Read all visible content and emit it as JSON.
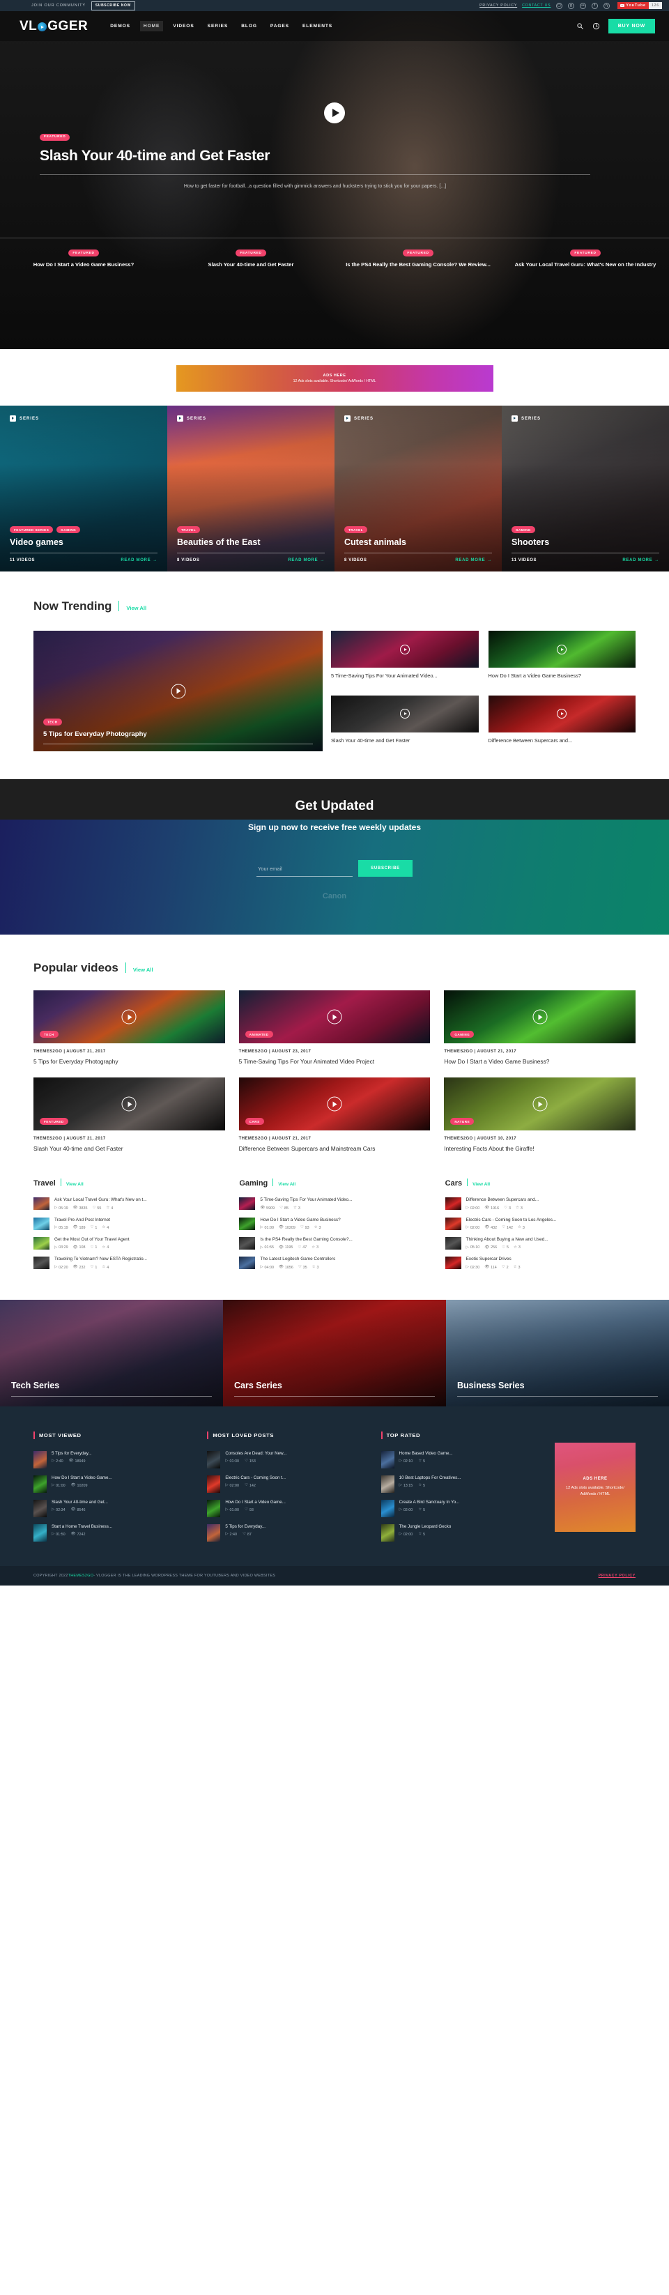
{
  "topbar": {
    "join_text": "JOIN OUR COMMUNITY",
    "subscribe_label": "SUBSCRIBE NOW",
    "links": [
      "PRIVACY POLICY",
      "CONTACT US"
    ],
    "social": [
      "instagram-icon",
      "google-plus-icon",
      "medium-icon",
      "facebook-icon",
      "behance-icon"
    ],
    "youtube_label": "YouTube",
    "youtube_count": "126"
  },
  "nav": {
    "logo": "VL",
    "logo_suffix": "GGER",
    "items": [
      "DEMOS",
      "HOME",
      "VIDEOS",
      "SERIES",
      "BLOG",
      "PAGES",
      "ELEMENTS"
    ],
    "active_index": 1,
    "buy_now": "BUY NOW",
    "accent": "#19dca6"
  },
  "hero": {
    "badge": "FEATURED",
    "title": "Slash Your 40-time and Get Faster",
    "desc": "How to get faster for football...a question filled with gimmick answers and hucksters trying to stick you for your papers. [...]",
    "strip": [
      {
        "badge": "FEATURED",
        "title": "How Do I Start a Video Game Business?"
      },
      {
        "badge": "FEATURED",
        "title": "Slash Your 40-time and Get Faster"
      },
      {
        "badge": "FEATURED",
        "title": "Is the PS4 Really the Best Gaming Console? We Review..."
      },
      {
        "badge": "FEATURED",
        "title": "Ask Your Local Travel Guru: What's New on the Industry"
      }
    ]
  },
  "ads_banner": {
    "title": "ADS HERE",
    "subtitle": "12 Ads slots available. Shortcode/ AdWords / HTML"
  },
  "series": {
    "label": "SERIES",
    "read_more": "READ MORE",
    "cards": [
      {
        "tags": [
          "FEATURED SERIES",
          "GAMING"
        ],
        "title": "Video games",
        "videos": "11 VIDEOS"
      },
      {
        "tags": [
          "TRAVEL"
        ],
        "title": "Beauties of the East",
        "videos": "8 VIDEOS"
      },
      {
        "tags": [
          "TRAVEL"
        ],
        "title": "Cutest animals",
        "videos": "8 VIDEOS"
      },
      {
        "tags": [
          "GAMING"
        ],
        "title": "Shooters",
        "videos": "11 VIDEOS"
      }
    ]
  },
  "trending": {
    "title": "Now Trending",
    "view_all": "View All",
    "main": {
      "badge": "TECH",
      "title": "5 Tips for Everyday Photography"
    },
    "side": [
      {
        "title": "5 Time-Saving Tips For Your Animated Video..."
      },
      {
        "title": "How Do I Start a Video Game Business?"
      },
      {
        "title": "Slash Your 40-time and Get Faster"
      },
      {
        "title": "Difference Between Supercars and..."
      }
    ]
  },
  "newsletter": {
    "title": "Get Updated",
    "subtitle": "Sign up now to receive free weekly updates",
    "placeholder": "Your email",
    "value": "",
    "button": "SUBSCRIBE",
    "brand": "Canon"
  },
  "popular": {
    "title": "Popular videos",
    "view_all": "View All",
    "items": [
      {
        "badge": "TECH",
        "meta": "THEMES2GO | AUGUST 21, 2017",
        "title": "5 Tips for Everyday Photography"
      },
      {
        "badge": "ANIMATED",
        "meta": "THEMES2GO | AUGUST 23, 2017",
        "title": "5 Time-Saving Tips For Your Animated Video Project"
      },
      {
        "badge": "GAMING",
        "meta": "THEMES2GO | AUGUST 21, 2017",
        "title": "How Do I Start a Video Game Business?"
      },
      {
        "badge": "FEATURED",
        "meta": "THEMES2GO | AUGUST 21, 2017",
        "title": "Slash Your 40-time and Get Faster"
      },
      {
        "badge": "CARS",
        "meta": "THEMES2GO | AUGUST 21, 2017",
        "title": "Difference Between Supercars and Mainstream Cars"
      },
      {
        "badge": "NATURE",
        "meta": "THEMES2GO | AUGUST 10, 2017",
        "title": "Interesting Facts About the Giraffe!"
      }
    ]
  },
  "categories": [
    {
      "title": "Travel",
      "view_all": "View All",
      "items": [
        {
          "name": "Ask Your Local Travel Guru: What's New on t...",
          "duration": "05:19",
          "views": "3835",
          "loves": "55",
          "rating": "4"
        },
        {
          "name": "Travel Pre And Post Internet",
          "duration": "05:19",
          "views": "189",
          "loves": "1",
          "rating": "4"
        },
        {
          "name": "Get the Most Out of Your Travel Agent",
          "duration": "03:29",
          "views": "108",
          "loves": "1",
          "rating": "4"
        },
        {
          "name": "Traveling To Vietnam? New ESTA Registratio...",
          "duration": "02:20",
          "views": "232",
          "loves": "1",
          "rating": "4"
        }
      ]
    },
    {
      "title": "Gaming",
      "view_all": "View All",
      "items": [
        {
          "name": "5 Time-Saving Tips For Your Animated Video...",
          "duration": "",
          "views": "5909",
          "loves": "85",
          "rating": "3"
        },
        {
          "name": "How Do I Start a Video Game Business?",
          "duration": "01:00",
          "views": "10209",
          "loves": "93",
          "rating": "3"
        },
        {
          "name": "Is the PS4 Really the Best Gaming Console?...",
          "duration": "01:55",
          "views": "1195",
          "loves": "47",
          "rating": "3"
        },
        {
          "name": "The Latest Logitech Game Controllers",
          "duration": "04:00",
          "views": "1056",
          "loves": "35",
          "rating": "3"
        }
      ]
    },
    {
      "title": "Cars",
      "view_all": "View All",
      "items": [
        {
          "name": "Difference Between Supercars and...",
          "duration": "02:00",
          "views": "1916",
          "loves": "3",
          "rating": "3"
        },
        {
          "name": "Electric Cars - Coming Soon to Los Angeles...",
          "duration": "02:00",
          "views": "432",
          "loves": "142",
          "rating": "3"
        },
        {
          "name": "Thinking About Buying a New and Used...",
          "duration": "05:10",
          "views": "256",
          "loves": "5",
          "rating": "3"
        },
        {
          "name": "Exotic Supercar Drives",
          "duration": "02:30",
          "views": "114",
          "loves": "2",
          "rating": "3"
        }
      ]
    }
  ],
  "banners": [
    {
      "title": "Tech Series"
    },
    {
      "title": "Cars Series"
    },
    {
      "title": "Business Series"
    }
  ],
  "footer": {
    "widgets": [
      {
        "title": "MOST VIEWED",
        "items": [
          {
            "name": "5 Tips for Everyday...",
            "duration": "2:40",
            "metric": "18949",
            "metric_icon": "eye-icon"
          },
          {
            "name": "How Do I Start a Video Game...",
            "duration": "01:00",
            "metric": "10209",
            "metric_icon": "eye-icon"
          },
          {
            "name": "Slash Your 40-time and Get...",
            "duration": "02:34",
            "metric": "8546",
            "metric_icon": "eye-icon"
          },
          {
            "name": "Start a Home Travel Business...",
            "duration": "01:50",
            "metric": "7242",
            "metric_icon": "eye-icon"
          }
        ]
      },
      {
        "title": "MOST LOVED POSTS",
        "items": [
          {
            "name": "Consoles Are Dead: Your New...",
            "duration": "01:30",
            "metric": "153",
            "metric_icon": "heart-icon"
          },
          {
            "name": "Electric Cars - Coming Soon t...",
            "duration": "02:00",
            "metric": "142",
            "metric_icon": "heart-icon"
          },
          {
            "name": "How Do I Start a Video Game...",
            "duration": "01:00",
            "metric": "93",
            "metric_icon": "heart-icon"
          },
          {
            "name": "5 Tips for Everyday...",
            "duration": "2:40",
            "metric": "87",
            "metric_icon": "heart-icon"
          }
        ]
      },
      {
        "title": "TOP RATED",
        "items": [
          {
            "name": "Home Based Video Game...",
            "duration": "02:10",
            "metric": "5",
            "metric_icon": "star-icon"
          },
          {
            "name": "10 Best Laptops For Creatives...",
            "duration": "13:15",
            "metric": "5",
            "metric_icon": "star-icon"
          },
          {
            "name": "Create A Bird Sanctuary In Yo...",
            "duration": "02:00",
            "metric": "5",
            "metric_icon": "star-icon"
          },
          {
            "name": "The Jungle Leopard Gecko",
            "duration": "02:00",
            "metric": "5",
            "metric_icon": "star-icon"
          }
        ]
      }
    ],
    "ad": {
      "title": "ADS HERE",
      "subtitle": "12 Ads slots available.\nShortcode/ AdWords / HTML"
    },
    "copyright_prefix": "COPYRIGHT 2022 ",
    "copyright_brand": "THEMES2GO",
    "copyright_suffix": " - VLOGGER IS THE LEADING WORDPRESS THEME FOR YOUTUBERS AND VIDEO WEBSITES",
    "privacy": "PRIVACY POLICY"
  }
}
